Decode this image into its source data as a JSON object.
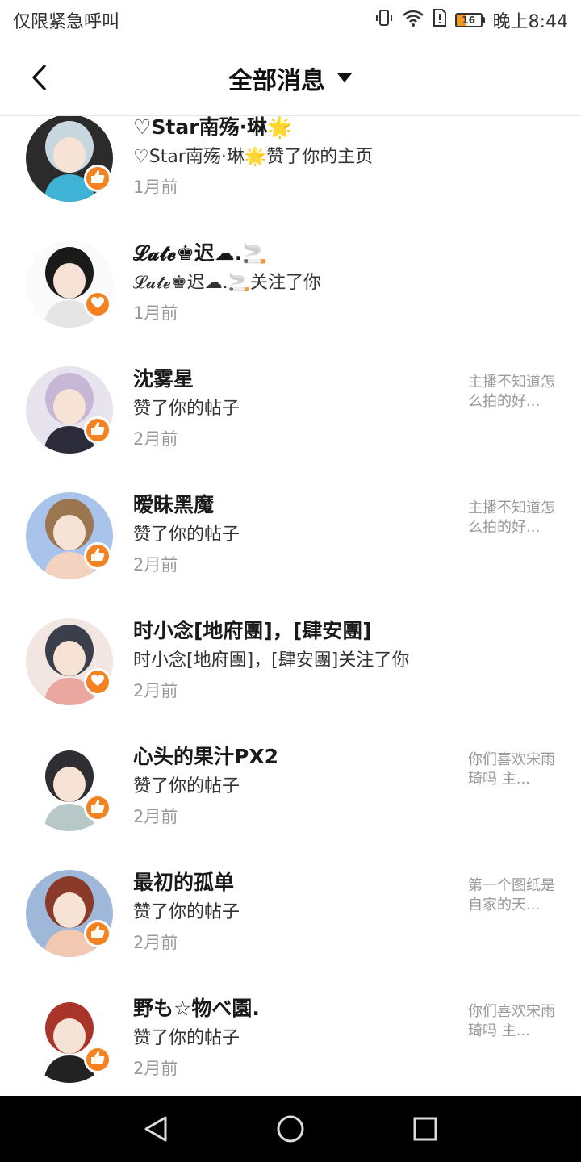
{
  "status_bar": {
    "left_text": "仅限紧急呼叫",
    "battery_level": "16",
    "time": "晚上8:44",
    "icons": [
      "vibrate-icon",
      "wifi-icon",
      "sim-alert-icon",
      "battery-icon"
    ]
  },
  "header": {
    "title": "全部消息",
    "back_icon": "back-arrow-icon",
    "dropdown_icon": "caret-down-icon"
  },
  "accent_color": "#f58220",
  "items": [
    {
      "name": "♡Star南殇·琳🌟",
      "desc": "♡Star南殇·琳🌟赞了你的主页",
      "time": "1月前",
      "preview": "",
      "badge": "like",
      "avatar_colors": [
        "#2b2b2b",
        "#c8d6e0",
        "#3fb3d6"
      ]
    },
    {
      "name": "𝓛𝓪𝓽𝓮♚迟☁.🚬",
      "desc": "𝓛𝓪𝓽𝓮♚迟☁.🚬关注了你",
      "time": "1月前",
      "preview": "",
      "badge": "follow",
      "avatar_colors": [
        "#fafafa",
        "#1a1a1a",
        "#e5e5e5"
      ]
    },
    {
      "name": "沈雾星",
      "desc": "赞了你的帖子",
      "time": "2月前",
      "preview": "主播不知道怎么拍的好...",
      "badge": "like",
      "avatar_colors": [
        "#e8e4ee",
        "#c7b7d6",
        "#2b2b3a"
      ]
    },
    {
      "name": "暧昧黑魔",
      "desc": "赞了你的帖子",
      "time": "2月前",
      "preview": "主播不知道怎么拍的好...",
      "badge": "like",
      "avatar_colors": [
        "#a9c4ea",
        "#9b7650",
        "#f3d2c0"
      ]
    },
    {
      "name": "时小念[地府團]，[肆安團]",
      "desc": "时小念[地府團]，[肆安團]关注了你",
      "time": "2月前",
      "preview": "",
      "badge": "follow",
      "avatar_colors": [
        "#f1e6e1",
        "#3b3f4c",
        "#e9a7a0"
      ]
    },
    {
      "name": "心头的果汁PX2",
      "desc": "赞了你的帖子",
      "time": "2月前",
      "preview": "你们喜欢宋雨琦吗 主...",
      "badge": "like",
      "avatar_colors": [
        "#ffffff",
        "#2f2f33",
        "#b8c8c8"
      ]
    },
    {
      "name": "最初的孤单",
      "desc": "赞了你的帖子",
      "time": "2月前",
      "preview": "第一个图纸是自家的天...",
      "badge": "like",
      "avatar_colors": [
        "#9fb7d9",
        "#8a3a2a",
        "#f2c8b0"
      ]
    },
    {
      "name": "野も☆物べ園.",
      "desc": "赞了你的帖子",
      "time": "2月前",
      "preview": "你们喜欢宋雨琦吗 主...",
      "badge": "like",
      "avatar_colors": [
        "#ffffff",
        "#a8342a",
        "#222222"
      ]
    }
  ],
  "nav_bar": {
    "icons": [
      "back-triangle-icon",
      "home-circle-icon",
      "recents-square-icon"
    ]
  }
}
